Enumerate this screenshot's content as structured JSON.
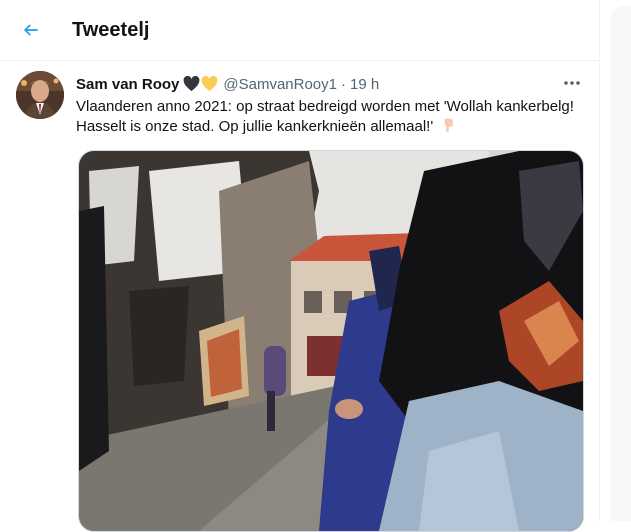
{
  "header": {
    "title": "Tweetelj",
    "back_icon": "arrow-left-icon"
  },
  "tweet": {
    "author_name": "Sam van Rooy",
    "handle": "@SamvanRooy1",
    "separator": "·",
    "time": "19 h",
    "emoji": [
      "black-heart",
      "yellow-heart"
    ],
    "text": "Vlaanderen anno 2021: op straat bedreigd worden met 'Wollah kankerbelg! Hasselt is onze stad. Op jullie kankerknieën allemaal!'",
    "trailing_emoji": "backhand-index-pointing-down",
    "more_icon": "more-dots-icon",
    "media_kind": "video-still"
  },
  "colors": {
    "accent": "#1d9bf0",
    "text_primary": "#0f1419",
    "text_secondary": "#536471",
    "border": "#eff3f4"
  }
}
